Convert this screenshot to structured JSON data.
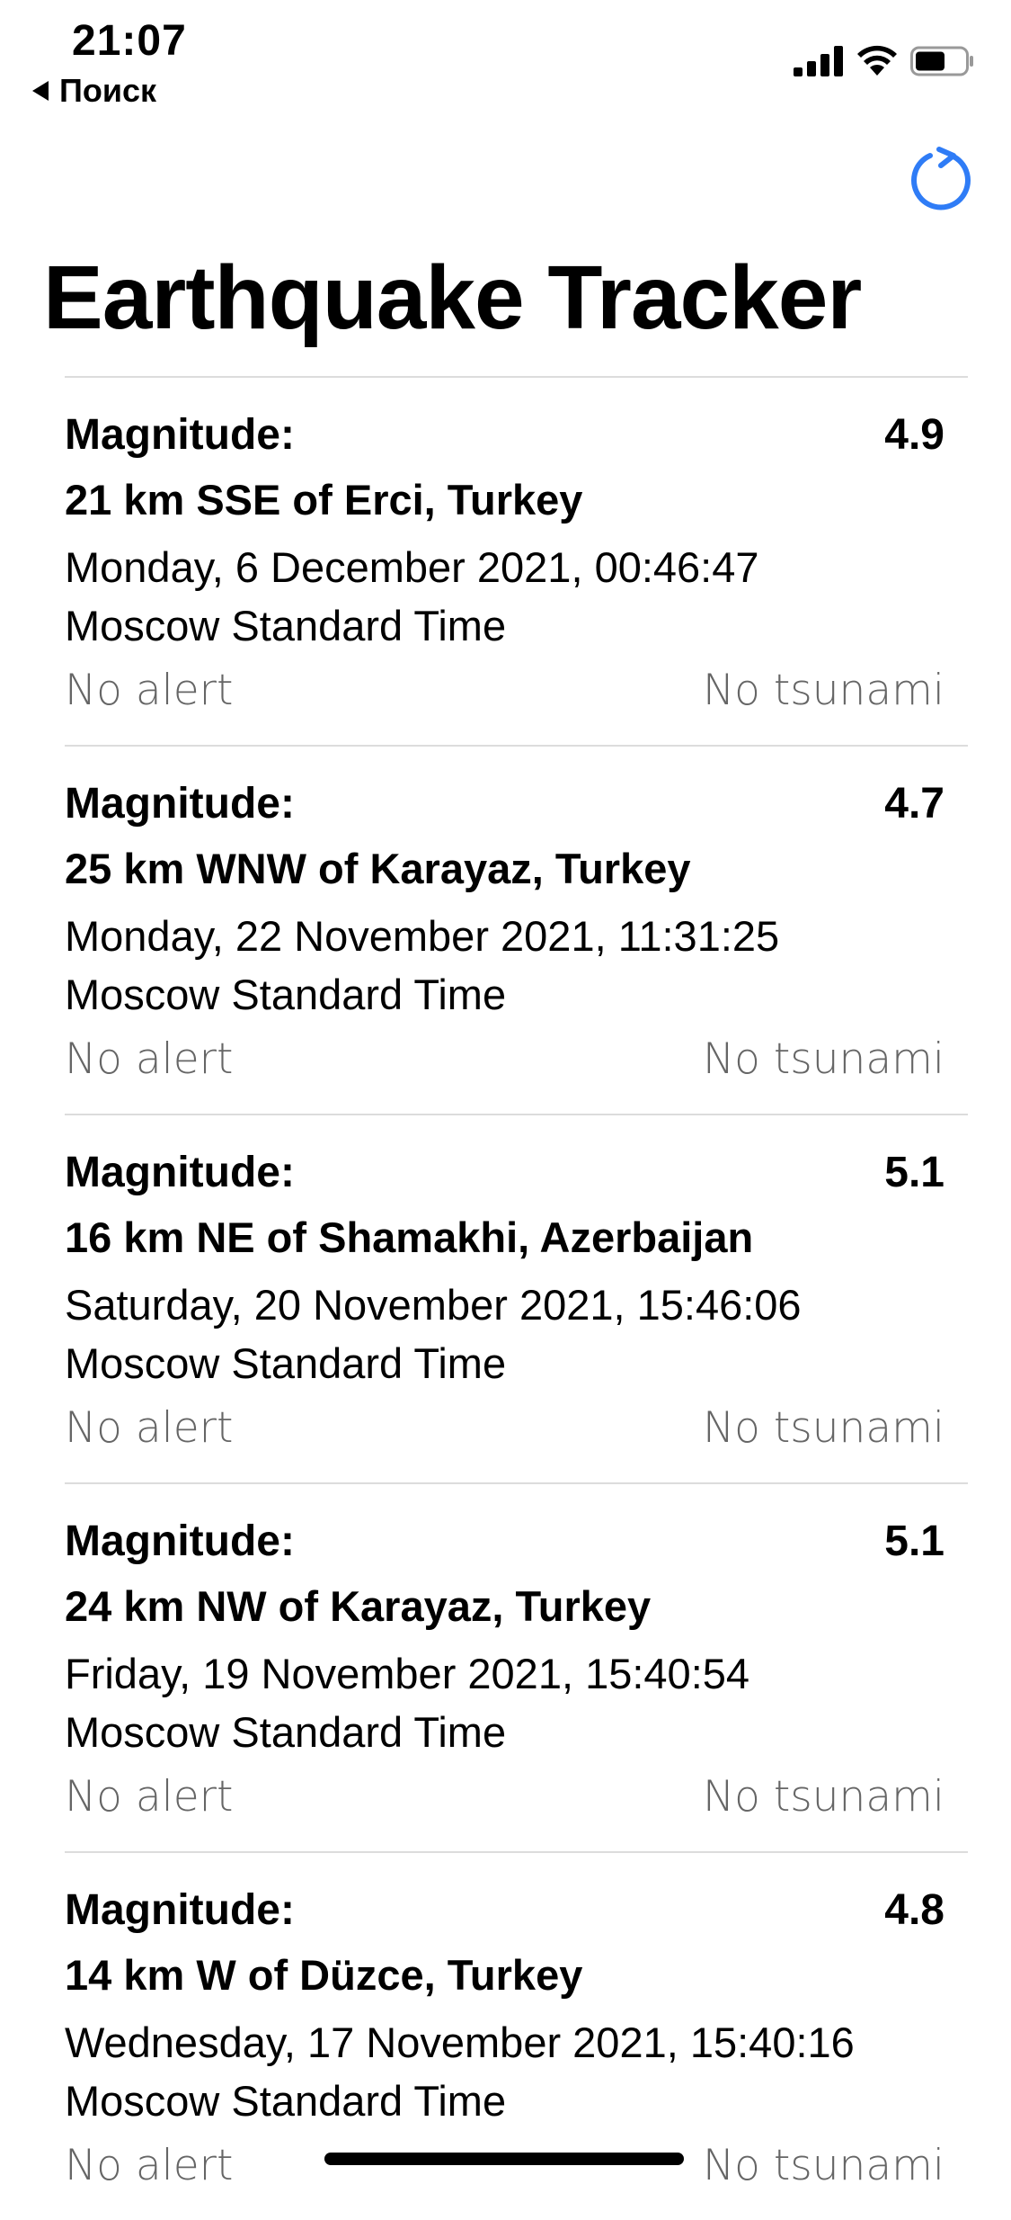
{
  "status_bar": {
    "time": "21:07",
    "back_label": "Поиск"
  },
  "header": {
    "title": "Earthquake Tracker",
    "refresh_icon": "refresh-icon",
    "accent_color": "#2f7cf6"
  },
  "earthquakes": [
    {
      "magnitude_label": "Magnitude:",
      "magnitude": "4.9",
      "place": "21 km SSE of Erci, Turkey",
      "date": "Monday, 6 December 2021, 00:46:47",
      "timezone": "Moscow Standard Time",
      "alert": "No alert",
      "tsunami": "No tsunami"
    },
    {
      "magnitude_label": "Magnitude:",
      "magnitude": "4.7",
      "place": "25 km WNW of Karayaz, Turkey",
      "date": "Monday, 22 November 2021, 11:31:25",
      "timezone": "Moscow Standard Time",
      "alert": "No alert",
      "tsunami": "No tsunami"
    },
    {
      "magnitude_label": "Magnitude:",
      "magnitude": "5.1",
      "place": "16 km NE of Shamakhi, Azerbaijan",
      "date": "Saturday, 20 November 2021, 15:46:06",
      "timezone": "Moscow Standard Time",
      "alert": "No alert",
      "tsunami": "No tsunami"
    },
    {
      "magnitude_label": "Magnitude:",
      "magnitude": "5.1",
      "place": "24 km NW of Karayaz, Turkey",
      "date": "Friday, 19 November 2021, 15:40:54",
      "timezone": "Moscow Standard Time",
      "alert": "No alert",
      "tsunami": "No tsunami"
    },
    {
      "magnitude_label": "Magnitude:",
      "magnitude": "4.8",
      "place": "14 km W of Düzce, Turkey",
      "date": "Wednesday, 17 November 2021, 15:40:16",
      "timezone": "Moscow Standard Time",
      "alert": "No alert",
      "tsunami": "No tsunami"
    }
  ]
}
